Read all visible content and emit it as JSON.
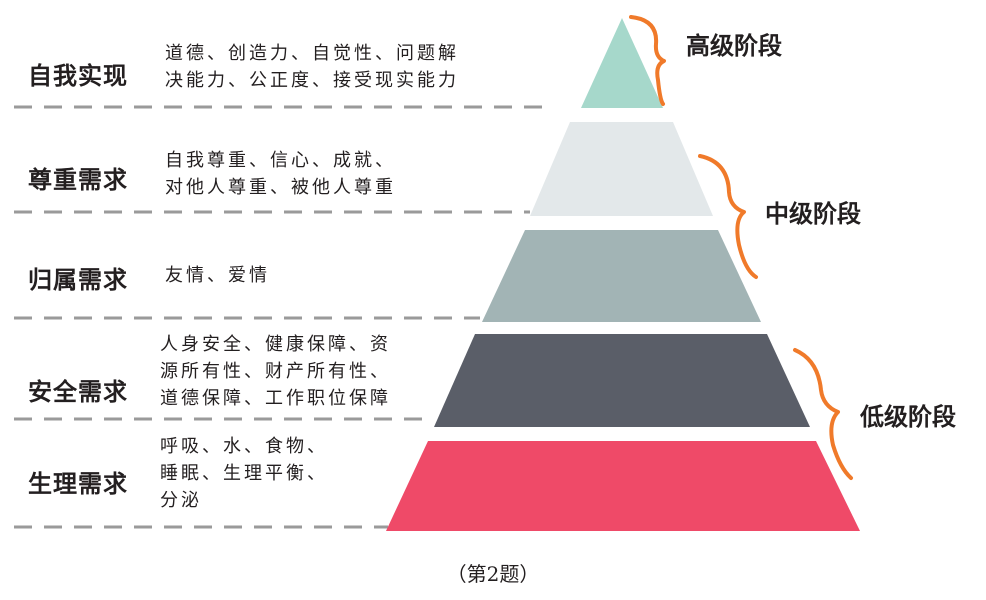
{
  "levels": [
    {
      "title": "自我实现",
      "lines": [
        "道德、创造力、自觉性、问题解",
        "决能力、公正度、接受现实能力"
      ],
      "color": "#a6d8cb"
    },
    {
      "title": "尊重需求",
      "lines": [
        "自我尊重、信心、成就、",
        "对他人尊重、被他人尊重"
      ],
      "color": "#e3e8ea"
    },
    {
      "title": "归属需求",
      "lines": [
        "友情、爱情"
      ],
      "color": "#a2b4b5"
    },
    {
      "title": "安全需求",
      "lines": [
        "人身安全、健康保障、资",
        "源所有性、财产所有性、",
        "道德保障、工作职位保障"
      ],
      "color": "#5a5e68"
    },
    {
      "title": "生理需求",
      "lines": [
        "呼吸、水、食物、",
        "睡眠、生理平衡、",
        "分泌"
      ],
      "color": "#ef4a68"
    }
  ],
  "stages": {
    "high": "高级阶段",
    "middle": "中级阶段",
    "low": "低级阶段"
  },
  "colors": {
    "brace": "#f07a2a",
    "dash": "#9a9a9a"
  },
  "caption": "（第2题）"
}
